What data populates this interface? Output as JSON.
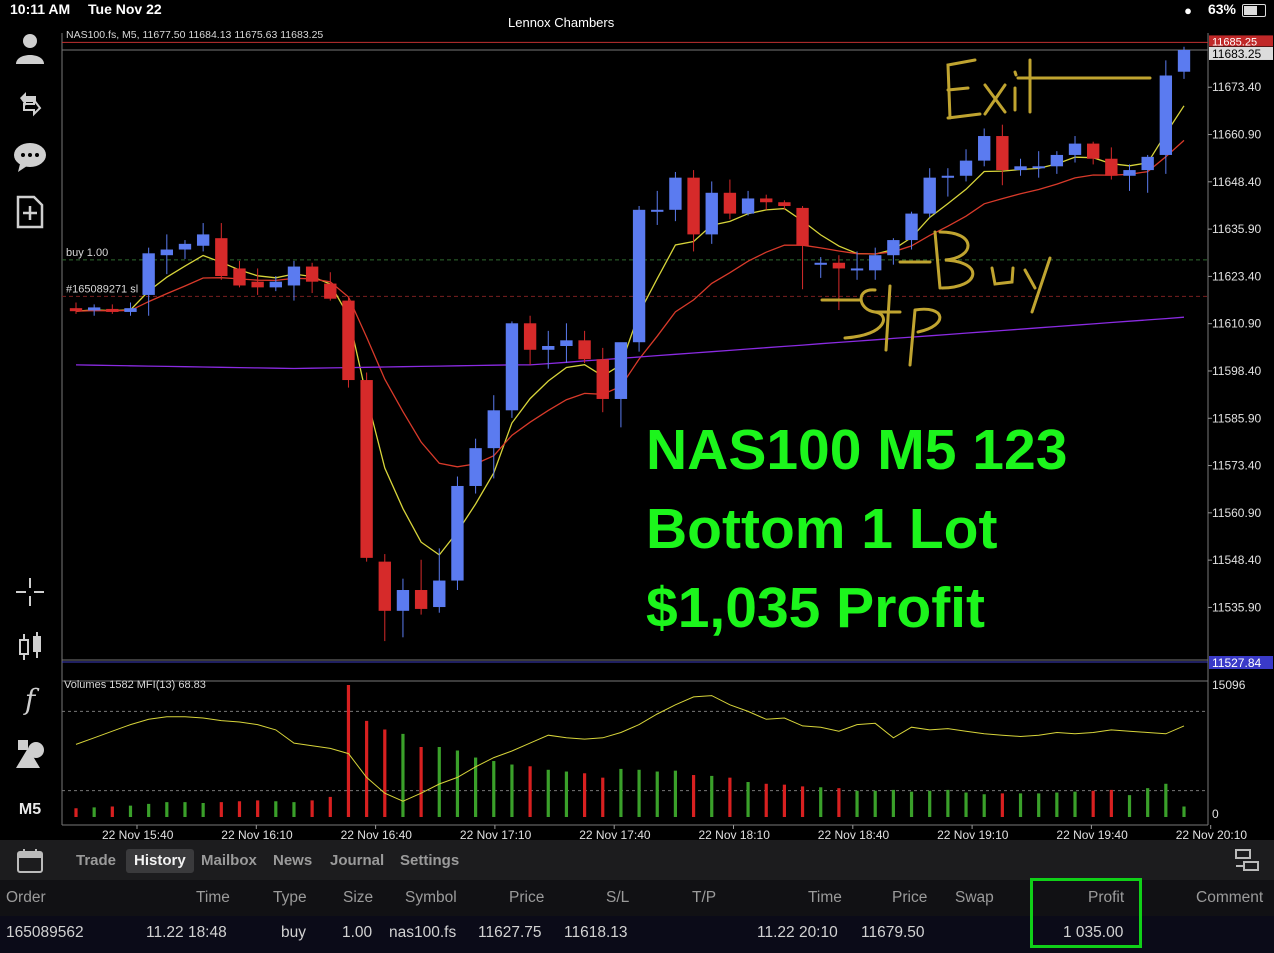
{
  "status_bar": {
    "time": "10:11 AM",
    "date": "Tue Nov 22",
    "account": "Lennox Chambers",
    "battery": "63%",
    "battery_level": 0.63
  },
  "sidebar": {
    "icons": [
      "account-icon",
      "trade-icon",
      "chat-icon",
      "new-order-icon",
      "crosshair-icon",
      "candles-icon",
      "indicators-icon",
      "objects-icon"
    ],
    "timeframe": "M5"
  },
  "overlay_text": {
    "line1": "NAS100 M5 123",
    "line2": "Bottom 1 Lot",
    "line3": "$1,035 Profit"
  },
  "annotations": {
    "exit": "Exit",
    "buy": "Buy",
    "stop": "Stop"
  },
  "colors": {
    "bull": "#5b7bf0",
    "bear": "#d62a2a",
    "ma_fast": "#d7d43a",
    "ma_slow": "#d83a2a",
    "ma_long": "#8a2be2",
    "mfi": "#d7d43a",
    "vol_up": "#3aa02a",
    "vol_down": "#d82020",
    "overlay": "#1cf51c",
    "handwriting": "#c0a430"
  },
  "chart_data": [
    {
      "type": "candlestick",
      "title": "NAS100.fs, M5, 11677.50 11684.13 11675.63 11683.25",
      "ylim": [
        11522,
        11688
      ],
      "y_ticks": [
        11673.4,
        11660.9,
        11648.4,
        11635.9,
        11623.4,
        11610.9,
        11598.4,
        11585.9,
        11573.4,
        11560.9,
        11548.4,
        11535.9
      ],
      "y_tick_labels": [
        "11673.40",
        "11660.90",
        "11648.40",
        "11635.90",
        "11623.40",
        "11610.90",
        "11598.40",
        "11585.90",
        "11573.40",
        "11560.90",
        "11548.40",
        "11535.90"
      ],
      "price_labels": {
        "ask": "11685.25",
        "bid": "11683.25",
        "low": "11527.84"
      },
      "levels": [
        {
          "name": "buy 1.00",
          "price": 11627.75,
          "color": "#2f6a2f"
        },
        {
          "name": "#165089271 sl",
          "price": 11618.13,
          "color": "#7a1f1f"
        }
      ],
      "candles": [
        {
          "o": 11615.0,
          "h": 11616.5,
          "l": 11613.5,
          "c": 11614.2
        },
        {
          "o": 11614.4,
          "h": 11616.0,
          "l": 11613.0,
          "c": 11615.2
        },
        {
          "o": 11614.8,
          "h": 11616.0,
          "l": 11613.5,
          "c": 11614.0
        },
        {
          "o": 11614.0,
          "h": 11616.5,
          "l": 11613.0,
          "c": 11615.0
        },
        {
          "o": 11618.5,
          "h": 11631.0,
          "l": 11613.0,
          "c": 11629.5
        },
        {
          "o": 11629.0,
          "h": 11634.5,
          "l": 11624.0,
          "c": 11630.5
        },
        {
          "o": 11630.5,
          "h": 11633.0,
          "l": 11628.0,
          "c": 11632.0
        },
        {
          "o": 11631.5,
          "h": 11637.5,
          "l": 11630.0,
          "c": 11634.5
        },
        {
          "o": 11633.5,
          "h": 11637.5,
          "l": 11622.5,
          "c": 11623.5
        },
        {
          "o": 11625.5,
          "h": 11627.5,
          "l": 11620.5,
          "c": 11621.0
        },
        {
          "o": 11622.0,
          "h": 11625.5,
          "l": 11618.5,
          "c": 11620.5
        },
        {
          "o": 11620.5,
          "h": 11623.5,
          "l": 11619.5,
          "c": 11622.0
        },
        {
          "o": 11621.0,
          "h": 11627.5,
          "l": 11617.0,
          "c": 11626.0
        },
        {
          "o": 11626.0,
          "h": 11627.0,
          "l": 11619.0,
          "c": 11622.0
        },
        {
          "o": 11621.5,
          "h": 11624.5,
          "l": 11617.0,
          "c": 11617.5
        },
        {
          "o": 11617.0,
          "h": 11618.0,
          "l": 11594.0,
          "c": 11596.0
        },
        {
          "o": 11596.0,
          "h": 11598.0,
          "l": 11548.0,
          "c": 11549.0
        },
        {
          "o": 11548.0,
          "h": 11550.0,
          "l": 11527.0,
          "c": 11535.0
        },
        {
          "o": 11535.0,
          "h": 11543.5,
          "l": 11528.0,
          "c": 11540.5
        },
        {
          "o": 11540.5,
          "h": 11548.5,
          "l": 11534.0,
          "c": 11535.5
        },
        {
          "o": 11536.0,
          "h": 11551.5,
          "l": 11534.5,
          "c": 11543.0
        },
        {
          "o": 11543.0,
          "h": 11570.5,
          "l": 11540.5,
          "c": 11568.0
        },
        {
          "o": 11568.0,
          "h": 11580.5,
          "l": 11566.0,
          "c": 11578.0
        },
        {
          "o": 11578.0,
          "h": 11592.0,
          "l": 11570.0,
          "c": 11588.0
        },
        {
          "o": 11588.0,
          "h": 11611.5,
          "l": 11586.0,
          "c": 11611.0
        },
        {
          "o": 11611.0,
          "h": 11613.0,
          "l": 11600.0,
          "c": 11604.0
        },
        {
          "o": 11604.0,
          "h": 11609.0,
          "l": 11599.0,
          "c": 11605.0
        },
        {
          "o": 11605.0,
          "h": 11611.0,
          "l": 11600.5,
          "c": 11606.5
        },
        {
          "o": 11606.5,
          "h": 11609.0,
          "l": 11600.5,
          "c": 11601.5
        },
        {
          "o": 11601.5,
          "h": 11604.5,
          "l": 11587.5,
          "c": 11591.0
        },
        {
          "o": 11591.0,
          "h": 11602.0,
          "l": 11583.5,
          "c": 11606.0
        },
        {
          "o": 11606.0,
          "h": 11642.0,
          "l": 11603.5,
          "c": 11641.0
        },
        {
          "o": 11641.0,
          "h": 11646.0,
          "l": 11637.0,
          "c": 11641.0
        },
        {
          "o": 11641.0,
          "h": 11651.0,
          "l": 11638.0,
          "c": 11649.5
        },
        {
          "o": 11649.5,
          "h": 11651.5,
          "l": 11630.0,
          "c": 11634.5
        },
        {
          "o": 11634.5,
          "h": 11648.5,
          "l": 11632.0,
          "c": 11645.5
        },
        {
          "o": 11645.5,
          "h": 11649.0,
          "l": 11638.5,
          "c": 11640.0
        },
        {
          "o": 11640.0,
          "h": 11646.0,
          "l": 11639.5,
          "c": 11644.0
        },
        {
          "o": 11644.0,
          "h": 11645.0,
          "l": 11641.0,
          "c": 11643.0
        },
        {
          "o": 11643.0,
          "h": 11643.5,
          "l": 11641.0,
          "c": 11642.0
        },
        {
          "o": 11641.5,
          "h": 11642.0,
          "l": 11620.0,
          "c": 11631.5
        },
        {
          "o": 11626.5,
          "h": 11628.5,
          "l": 11623.0,
          "c": 11627.0
        },
        {
          "o": 11627.0,
          "h": 11629.0,
          "l": 11614.5,
          "c": 11625.5
        },
        {
          "o": 11625.5,
          "h": 11630.0,
          "l": 11622.5,
          "c": 11625.5
        },
        {
          "o": 11625.0,
          "h": 11631.0,
          "l": 11622.5,
          "c": 11629.0
        },
        {
          "o": 11629.0,
          "h": 11633.5,
          "l": 11626.5,
          "c": 11633.0
        },
        {
          "o": 11633.0,
          "h": 11640.5,
          "l": 11630.5,
          "c": 11640.0
        },
        {
          "o": 11640.0,
          "h": 11652.0,
          "l": 11639.0,
          "c": 11649.5
        },
        {
          "o": 11649.5,
          "h": 11652.0,
          "l": 11644.5,
          "c": 11650.0
        },
        {
          "o": 11650.0,
          "h": 11657.0,
          "l": 11648.5,
          "c": 11654.0
        },
        {
          "o": 11654.0,
          "h": 11662.5,
          "l": 11652.5,
          "c": 11660.5
        },
        {
          "o": 11660.5,
          "h": 11663.5,
          "l": 11647.5,
          "c": 11651.5
        },
        {
          "o": 11651.5,
          "h": 11654.5,
          "l": 11650.0,
          "c": 11652.5
        },
        {
          "o": 11652.5,
          "h": 11656.5,
          "l": 11649.5,
          "c": 11652.5
        },
        {
          "o": 11652.5,
          "h": 11656.5,
          "l": 11650.5,
          "c": 11655.5
        },
        {
          "o": 11655.5,
          "h": 11660.5,
          "l": 11653.5,
          "c": 11658.5
        },
        {
          "o": 11658.5,
          "h": 11659.0,
          "l": 11653.0,
          "c": 11654.5
        },
        {
          "o": 11654.5,
          "h": 11657.5,
          "l": 11649.0,
          "c": 11650.0
        },
        {
          "o": 11650.0,
          "h": 11653.0,
          "l": 11646.0,
          "c": 11651.5
        },
        {
          "o": 11651.5,
          "h": 11655.5,
          "l": 11645.5,
          "c": 11655.0
        },
        {
          "o": 11655.5,
          "h": 11680.5,
          "l": 11650.5,
          "c": 11676.5
        },
        {
          "o": 11677.5,
          "h": 11684.1,
          "l": 11675.6,
          "c": 11683.25
        }
      ]
    },
    {
      "type": "bar",
      "title": "Volumes 1582 MFI(13) 68.83",
      "ylim": [
        0,
        15096
      ],
      "y_tick_labels": [
        "15096",
        "0"
      ],
      "x_tick_labels": [
        "22 Nov 15:40",
        "22 Nov 16:10",
        "22 Nov 16:40",
        "22 Nov 17:10",
        "22 Nov 17:40",
        "22 Nov 18:10",
        "22 Nov 18:40",
        "22 Nov 19:10",
        "22 Nov 19:40",
        "22 Nov 20:10"
      ],
      "volumes": [
        1000,
        1100,
        1200,
        1300,
        1500,
        1700,
        1700,
        1600,
        1700,
        1800,
        1900,
        1800,
        1700,
        1900,
        2300,
        15096,
        11000,
        10000,
        9500,
        8000,
        8000,
        7600,
        6800,
        6400,
        6000,
        5800,
        5400,
        5200,
        5000,
        4500,
        5500,
        5400,
        5200,
        5300,
        4800,
        4700,
        4500,
        4000,
        3800,
        3700,
        3500,
        3400,
        3300,
        3000,
        3000,
        3100,
        2900,
        3000,
        3100,
        2800,
        2600,
        2700,
        2700,
        2700,
        2800,
        2900,
        3000,
        3100,
        2500,
        3300,
        3800,
        1200
      ],
      "mfi": [
        55,
        60,
        65,
        70,
        74,
        76,
        76,
        75,
        73,
        72,
        70,
        66,
        56,
        54,
        52,
        48,
        30,
        18,
        12,
        18,
        25,
        30,
        38,
        45,
        50,
        56,
        62,
        60,
        59,
        60,
        64,
        70,
        78,
        85,
        91,
        92,
        85,
        80,
        74,
        75,
        69,
        68,
        65,
        70,
        71,
        60,
        68,
        66,
        67,
        65,
        63,
        62,
        61,
        62,
        64,
        63,
        64,
        66,
        65,
        64,
        63,
        69
      ],
      "mfi_levels": [
        80,
        20
      ]
    }
  ],
  "tabs": [
    {
      "label": "Trade",
      "active": false
    },
    {
      "label": "History",
      "active": true
    },
    {
      "label": "Mailbox",
      "active": false
    },
    {
      "label": "News",
      "active": false
    },
    {
      "label": "Journal",
      "active": false
    },
    {
      "label": "Settings",
      "active": false
    }
  ],
  "history_table": {
    "headers": {
      "order": "Order",
      "time": "Time",
      "type": "Type",
      "size": "Size",
      "symbol": "Symbol",
      "price": "Price",
      "sl": "S/L",
      "tp": "T/P",
      "time2": "Time",
      "price2": "Price",
      "swap": "Swap",
      "profit": "Profit",
      "comment": "Comment"
    },
    "row": {
      "order": "165089562",
      "time": "11.22 18:48",
      "type": "buy",
      "size": "1.00",
      "symbol": "nas100.fs",
      "price": "11627.75",
      "sl": "11618.13",
      "tp": "",
      "time2": "11.22 20:10",
      "price2": "11679.50",
      "swap": "",
      "profit": "1 035.00",
      "comment": ""
    }
  }
}
